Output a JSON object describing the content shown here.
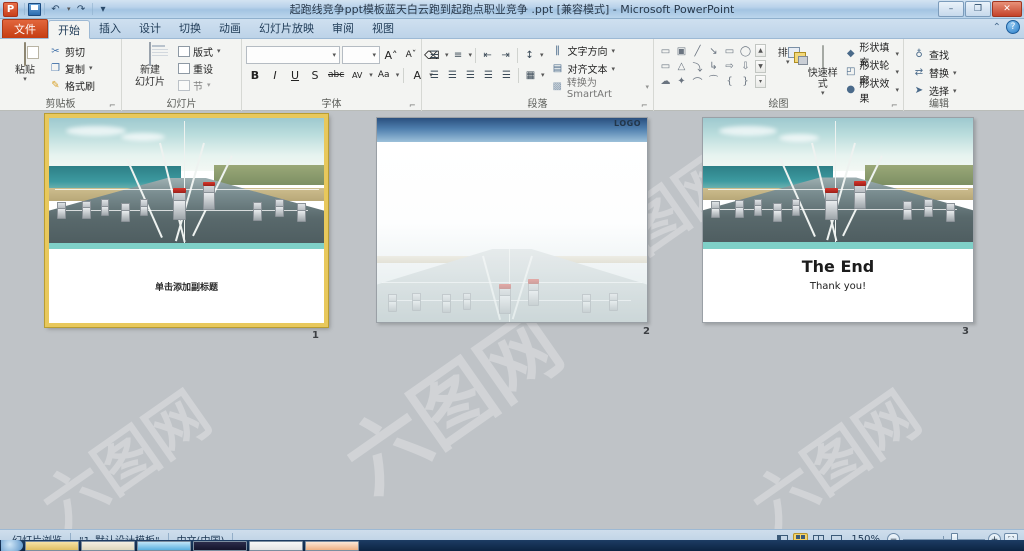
{
  "titlebar": {
    "app_icon": "powerpoint-icon",
    "title": "起跑线竞争ppt模板蓝天白云跑到起跑点职业竞争 .ppt [兼容模式]  -  Microsoft PowerPoint",
    "quick_access": [
      {
        "name": "save",
        "glyph": "▣"
      },
      {
        "name": "undo",
        "glyph": "↶"
      },
      {
        "name": "redo",
        "glyph": "↷"
      },
      {
        "name": "customize",
        "glyph": "▾"
      }
    ],
    "window_controls": [
      {
        "name": "minimize",
        "glyph": "–"
      },
      {
        "name": "restore",
        "glyph": "❐"
      },
      {
        "name": "close",
        "glyph": "✕"
      }
    ]
  },
  "tabs": [
    {
      "label": "文件",
      "kind": "file"
    },
    {
      "label": "开始",
      "kind": "active"
    },
    {
      "label": "插入",
      "kind": "normal"
    },
    {
      "label": "设计",
      "kind": "normal"
    },
    {
      "label": "切换",
      "kind": "normal"
    },
    {
      "label": "动画",
      "kind": "normal"
    },
    {
      "label": "幻灯片放映",
      "kind": "normal"
    },
    {
      "label": "审阅",
      "kind": "normal"
    },
    {
      "label": "视图",
      "kind": "normal"
    }
  ],
  "ribbon_helpers": [
    {
      "name": "minimize-ribbon",
      "glyph": "⌃"
    },
    {
      "name": "help",
      "glyph": "?"
    }
  ],
  "ribbon": {
    "clipboard": {
      "label": "剪贴板",
      "paste": "粘贴",
      "items": [
        {
          "label": "剪切",
          "icon": "scissors-icon",
          "glyph": "✂"
        },
        {
          "label": "复制",
          "icon": "copy-icon",
          "glyph": "❐"
        },
        {
          "label": "格式刷",
          "icon": "format-painter-icon",
          "glyph": "✎"
        }
      ]
    },
    "slides": {
      "label": "幻灯片",
      "new_slide": "新建\n幻灯片",
      "new_slide_line1": "新建",
      "new_slide_line2": "幻灯片",
      "items": [
        {
          "label": "版式",
          "icon": "layout-icon"
        },
        {
          "label": "重设",
          "icon": "reset-icon"
        },
        {
          "label": "节",
          "icon": "section-icon"
        }
      ]
    },
    "font": {
      "label": "字体",
      "font_name_value": "",
      "font_size_value": "",
      "buttons": [
        {
          "name": "grow-font",
          "glyph": "A˄"
        },
        {
          "name": "shrink-font",
          "glyph": "Aˇ"
        },
        {
          "name": "clear-formatting",
          "glyph": "⌫"
        },
        {
          "name": "bold",
          "glyph": "B"
        },
        {
          "name": "italic",
          "glyph": "I"
        },
        {
          "name": "underline",
          "glyph": "U"
        },
        {
          "name": "shadow",
          "glyph": "S"
        },
        {
          "name": "strikethrough",
          "glyph": "abc"
        },
        {
          "name": "character-spacing",
          "glyph": "AV"
        },
        {
          "name": "change-case",
          "glyph": "Aa"
        },
        {
          "name": "font-color",
          "glyph": "A"
        }
      ]
    },
    "paragraph": {
      "label": "段落",
      "buttons": [
        {
          "name": "bullets",
          "glyph": "☰"
        },
        {
          "name": "numbering",
          "glyph": "≡"
        },
        {
          "name": "decrease-indent",
          "glyph": "⇤"
        },
        {
          "name": "increase-indent",
          "glyph": "⇥"
        },
        {
          "name": "line-spacing",
          "glyph": "↕"
        },
        {
          "name": "align-left",
          "glyph": "☰"
        },
        {
          "name": "align-center",
          "glyph": "☰"
        },
        {
          "name": "align-right",
          "glyph": "☰"
        },
        {
          "name": "justify",
          "glyph": "☰"
        },
        {
          "name": "distribute",
          "glyph": "☰"
        },
        {
          "name": "columns",
          "glyph": "▦"
        }
      ],
      "items": [
        {
          "label": "文字方向",
          "icon": "text-direction-icon",
          "glyph": "‖"
        },
        {
          "label": "对齐文本",
          "icon": "align-text-icon",
          "glyph": "▤"
        },
        {
          "label": "转换为 SmartArt",
          "icon": "smartart-icon",
          "glyph": "▩"
        }
      ]
    },
    "drawing": {
      "label": "绘图",
      "shapes": [
        "▭",
        "▣",
        "╱",
        "↘",
        "▭",
        "◯",
        "▭",
        "△",
        "⤵",
        "↳",
        "⇨",
        "⇩",
        "☁",
        "✦",
        "⌒",
        "⁀",
        "{",
        "}"
      ],
      "arrange": "排列",
      "quick_styles": "快速样式",
      "items": [
        {
          "label": "形状填充",
          "icon": "shape-fill-icon",
          "glyph": "◆"
        },
        {
          "label": "形状轮廓",
          "icon": "shape-outline-icon",
          "glyph": "◰"
        },
        {
          "label": "形状效果",
          "icon": "shape-effects-icon",
          "glyph": "●"
        }
      ]
    },
    "editing": {
      "label": "编辑",
      "items": [
        {
          "label": "查找",
          "icon": "find-icon",
          "glyph": "♁"
        },
        {
          "label": "替换",
          "icon": "replace-icon",
          "glyph": "⇄"
        },
        {
          "label": "选择",
          "icon": "select-icon",
          "glyph": "➤"
        }
      ]
    }
  },
  "slides": [
    {
      "number": "1",
      "selected": true,
      "type": "title",
      "subtitle": "单击添加副标题"
    },
    {
      "number": "2",
      "selected": false,
      "type": "content",
      "logo": "LOGO"
    },
    {
      "number": "3",
      "selected": false,
      "type": "end",
      "title": "The End",
      "subtitle": "Thank you!"
    }
  ],
  "statusbar": {
    "view_name": "幻灯片浏览",
    "theme": "\"1_默认设计模板\"",
    "language": "中文(中国)",
    "zoom_level": "150%",
    "view_buttons": [
      {
        "name": "normal-view",
        "active": false
      },
      {
        "name": "slide-sorter-view",
        "active": true
      },
      {
        "name": "reading-view",
        "active": false
      },
      {
        "name": "slideshow-view",
        "active": false
      }
    ],
    "zoom_out": "−",
    "zoom_in": "+",
    "fit_window": "⛶"
  },
  "watermark_text": "六图网",
  "colors": {
    "accent_orange": "#c53d13",
    "selection_gold": "#e8c85c",
    "workspace_gray": "#bfc3c7",
    "titlebar_blue": "#a3c4e2",
    "close_red": "#c4432a"
  }
}
